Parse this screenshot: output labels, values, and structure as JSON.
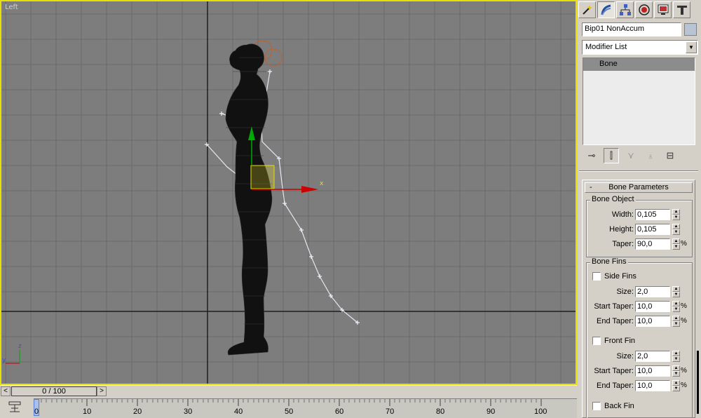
{
  "viewport": {
    "label": "Left",
    "axis_x_label": "x",
    "mini_axis_z": "z",
    "mini_axis_y": "y"
  },
  "time_slider": {
    "left_arrow": "<",
    "position": "0 / 100",
    "right_arrow": ">"
  },
  "trackbar": {
    "ticks": [
      "0",
      "10",
      "20",
      "30",
      "40",
      "50",
      "60",
      "70",
      "80",
      "90",
      "100"
    ]
  },
  "command_panel": {
    "tabs": [
      "create-icon",
      "modify-icon",
      "hierarchy-icon",
      "motion-icon",
      "display-icon",
      "utilities-icon"
    ],
    "object_name": "Bip01 NonAccum",
    "object_color": "#b8c4d4",
    "modifier_list": "Modifier List",
    "stack_items": [
      "Bone"
    ],
    "rollout": {
      "collapse": "-",
      "title": "Bone Parameters",
      "bone_object": {
        "title": "Bone Object",
        "width_label": "Width:",
        "width_value": "0,105",
        "height_label": "Height:",
        "height_value": "0,105",
        "taper_label": "Taper:",
        "taper_value": "90,0",
        "taper_unit": "%"
      },
      "bone_fins": {
        "title": "Bone Fins",
        "side_fins_label": "Side Fins",
        "side_size_label": "Size:",
        "side_size_value": "2,0",
        "side_start_label": "Start Taper:",
        "side_start_value": "10,0",
        "side_end_label": "End Taper:",
        "side_end_value": "10,0",
        "front_fin_label": "Front Fin",
        "front_size_label": "Size:",
        "front_size_value": "2,0",
        "front_start_label": "Start Taper:",
        "front_start_value": "10,0",
        "front_end_label": "End Taper:",
        "front_end_value": "10,0",
        "back_fin_label": "Back Fin",
        "pct": "%"
      }
    }
  },
  "colors": {
    "viewport_bg": "#7d7d7d",
    "active_border": "#e8e000",
    "grid": "#6a6a6a",
    "axis_x": "#cc0000",
    "axis_y": "#00aa00"
  }
}
